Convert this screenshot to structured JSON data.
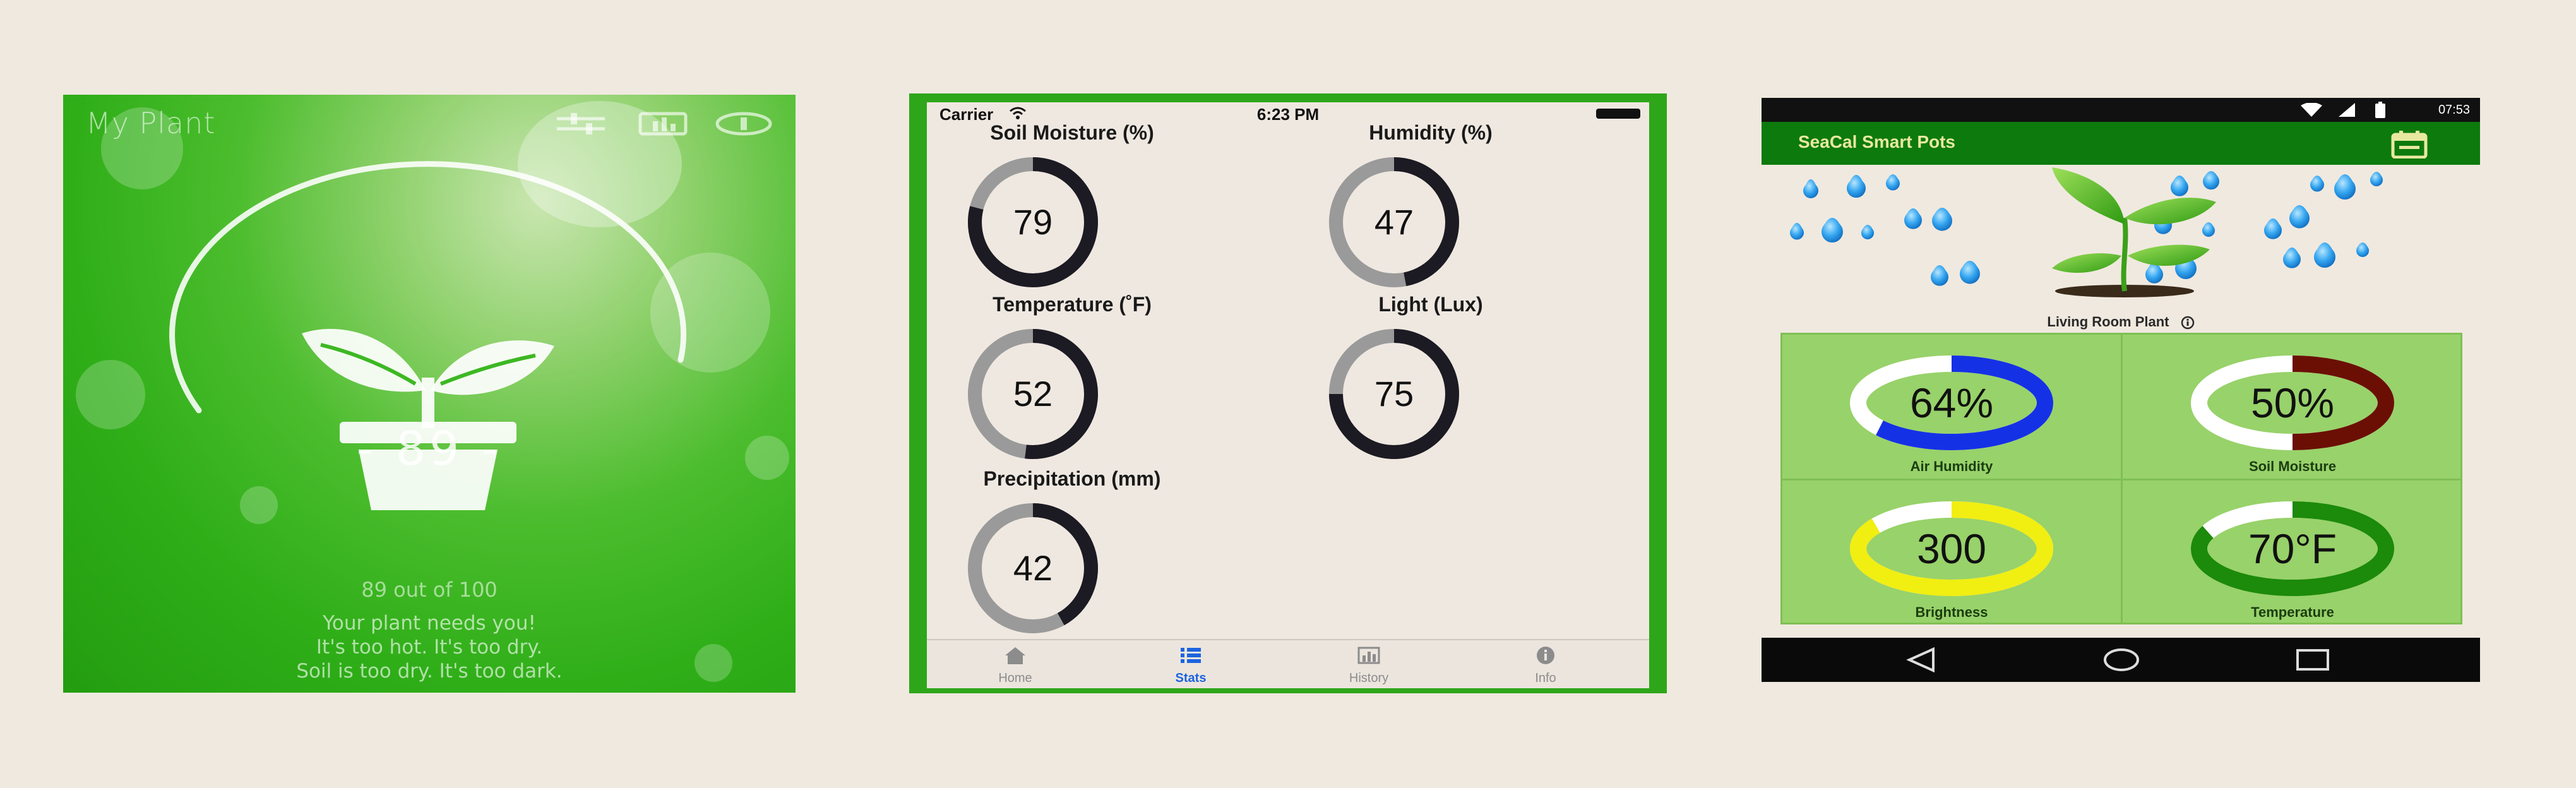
{
  "screen1": {
    "title": "My Plant",
    "score": "- 89 -",
    "score_out_of": "89 out of 100",
    "message_lines": [
      "Your plant needs you!",
      "It's too hot. It's too dry.",
      "Soil is too dry. It's too dark."
    ],
    "score_value": 89,
    "score_max": 100,
    "icons": [
      "sliders-icon",
      "chart-icon",
      "info-icon",
      "plant-pot-icon"
    ]
  },
  "screen2": {
    "status": {
      "carrier": "Carrier",
      "time": "6:23 PM"
    },
    "gauges": [
      {
        "label": "Soil Moisture (%)",
        "value": "79",
        "fraction": 0.79
      },
      {
        "label": "Humidity (%)",
        "value": "47",
        "fraction": 0.47
      },
      {
        "label": "Temperature (˚F)",
        "value": "52",
        "fraction": 0.52
      },
      {
        "label": "Light (Lux)",
        "value": "75",
        "fraction": 0.75
      },
      {
        "label": "Precipitation (mm)",
        "value": "42",
        "fraction": 0.42
      }
    ],
    "tabs": [
      {
        "label": "Home",
        "icon": "home-icon",
        "active": false
      },
      {
        "label": "Stats",
        "icon": "list-icon",
        "active": true
      },
      {
        "label": "History",
        "icon": "bar-chart-icon",
        "active": false
      },
      {
        "label": "Info",
        "icon": "info-icon",
        "active": false
      }
    ],
    "colors": {
      "frame": "#2ea61a",
      "active_tab": "#1b64e0",
      "gauge_fill": "#1c1a22",
      "gauge_track": "#9a9a9a"
    }
  },
  "screen3": {
    "status": {
      "clock": "07:53"
    },
    "app_title": "SeaCal Smart Pots",
    "plant_name": "Living Room Plant",
    "tiles": [
      {
        "label": "Air Humidity",
        "value": "64%",
        "fraction": 0.64,
        "color": "#1531e6",
        "track": "#ffffff"
      },
      {
        "label": "Soil Moisture",
        "value": "50%",
        "fraction": 0.5,
        "color": "#6b0f05",
        "track": "#ffffff"
      },
      {
        "label": "Brightness",
        "value": "300",
        "fraction": 0.85,
        "color": "#f1ee12",
        "track": "#ffffff"
      },
      {
        "label": "Temperature",
        "value": "70°F",
        "fraction": 0.82,
        "color": "#1c8a0a",
        "track": "#ffffff"
      }
    ],
    "nav": [
      "back-icon",
      "home-icon",
      "recents-icon"
    ],
    "colors": {
      "appbar": "#0d7a0d",
      "title": "#e8e8a0",
      "grid": "#98d26a"
    }
  }
}
